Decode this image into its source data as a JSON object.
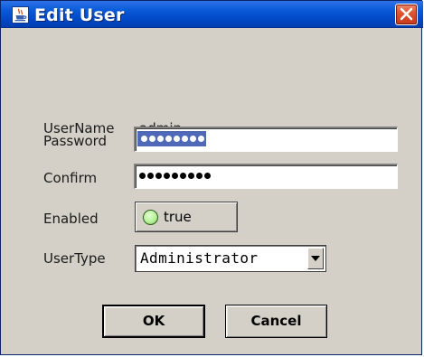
{
  "window": {
    "title": "Edit User",
    "app_icon": "java-cup-icon",
    "close_icon": "close-icon"
  },
  "form": {
    "username_label": "UserName",
    "username_value": "admin",
    "password_label": "Password",
    "password_masked_length": 8,
    "confirm_label": "Confirm",
    "confirm_masked_length": 9,
    "enabled_label": "Enabled",
    "enabled_value": "true",
    "usertype_label": "UserType",
    "usertype_value": "Administrator"
  },
  "buttons": {
    "ok": "OK",
    "cancel": "Cancel"
  },
  "colors": {
    "titlebar": "#0a5bd9",
    "dialog_bg": "#d4d0c8",
    "selection": "#4f69b8",
    "toggle_led": "#b7f29a",
    "close_button": "#e0552f"
  }
}
